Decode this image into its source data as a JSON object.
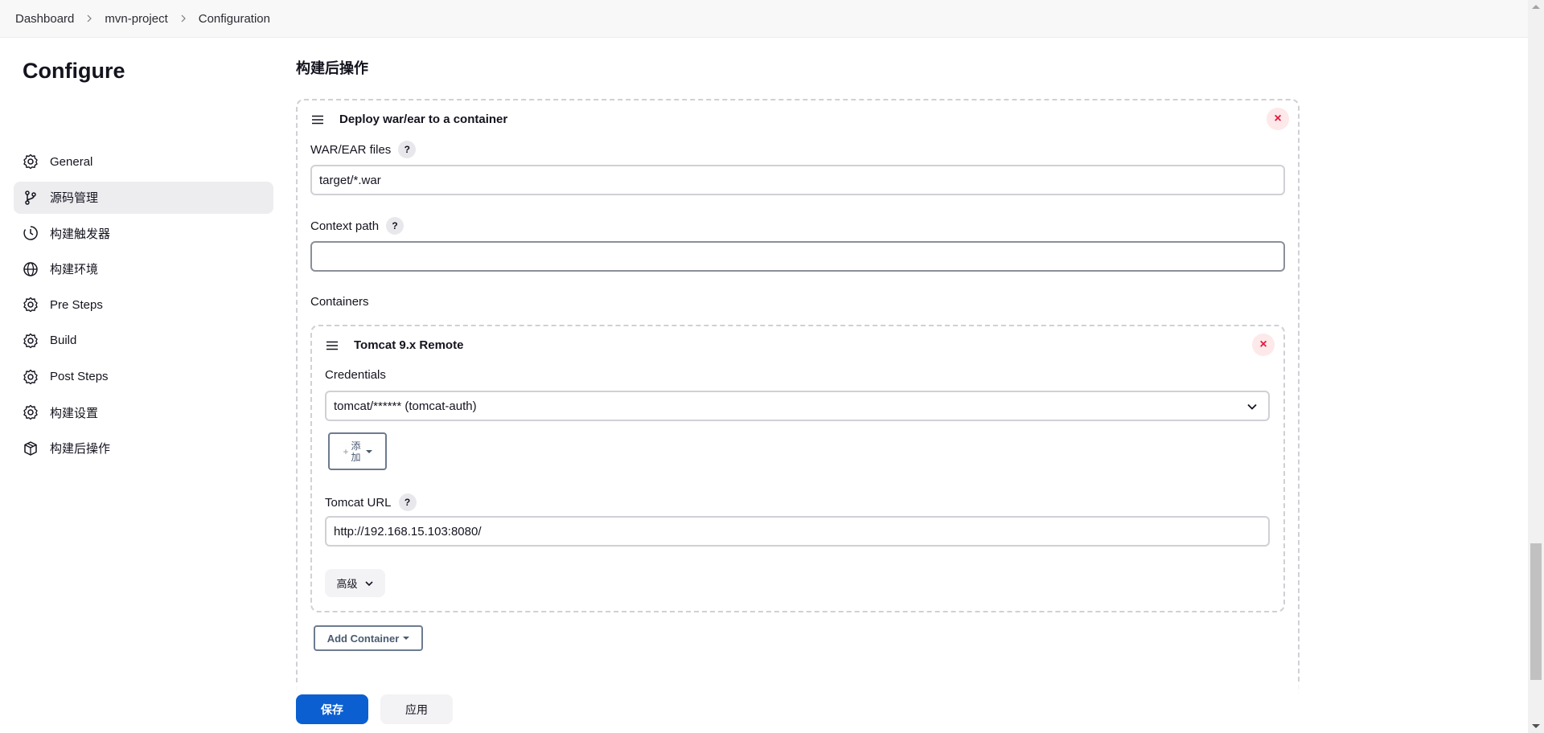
{
  "breadcrumb": [
    "Dashboard",
    "mvn-project",
    "Configuration"
  ],
  "sidebar": {
    "title": "Configure",
    "items": [
      {
        "label": "General",
        "icon": "gear-icon",
        "active": false
      },
      {
        "label": "源码管理",
        "icon": "branch-icon",
        "active": true
      },
      {
        "label": "构建触发器",
        "icon": "clock-icon",
        "active": false
      },
      {
        "label": "构建环境",
        "icon": "globe-icon",
        "active": false
      },
      {
        "label": "Pre Steps",
        "icon": "gear-icon",
        "active": false
      },
      {
        "label": "Build",
        "icon": "gear-icon",
        "active": false
      },
      {
        "label": "Post Steps",
        "icon": "gear-icon",
        "active": false
      },
      {
        "label": "构建设置",
        "icon": "gear-icon",
        "active": false
      },
      {
        "label": "构建后操作",
        "icon": "package-icon",
        "active": false
      }
    ]
  },
  "main": {
    "section_title": "构建后操作",
    "deploy": {
      "title": "Deploy war/ear to a container",
      "war_label": "WAR/EAR files",
      "war_value": "target/*.war",
      "context_label": "Context path",
      "context_value": "",
      "containers_label": "Containers",
      "help_symbol": "?",
      "close_symbol": "×"
    },
    "tomcat": {
      "title": "Tomcat 9.x Remote",
      "credentials_label": "Credentials",
      "credentials_value": "tomcat/****** (tomcat-auth)",
      "add_button_label": "添加",
      "url_label": "Tomcat URL",
      "url_value": "http://192.168.15.103:8080/",
      "advanced_label": "高级"
    },
    "add_container_label": "Add Container"
  },
  "footer": {
    "save_label": "保存",
    "apply_label": "应用"
  },
  "colors": {
    "primary": "#0b5fd1",
    "danger": "#e01b3c",
    "active_nav": "#ededf0"
  }
}
